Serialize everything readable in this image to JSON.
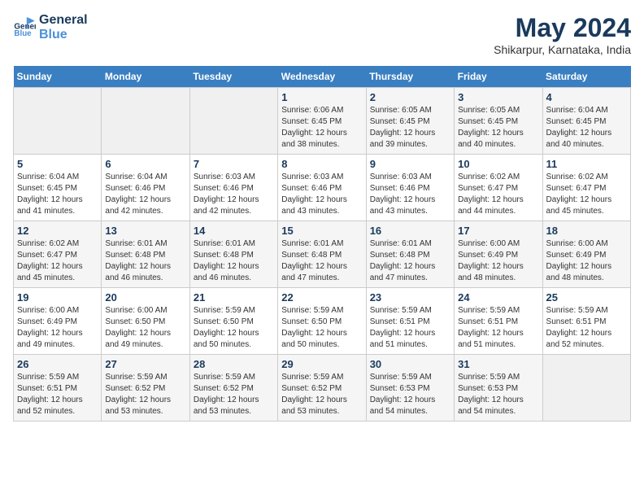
{
  "logo": {
    "line1": "General",
    "line2": "Blue"
  },
  "title": "May 2024",
  "location": "Shikarpur, Karnataka, India",
  "days_of_week": [
    "Sunday",
    "Monday",
    "Tuesday",
    "Wednesday",
    "Thursday",
    "Friday",
    "Saturday"
  ],
  "weeks": [
    [
      {
        "day": "",
        "info": ""
      },
      {
        "day": "",
        "info": ""
      },
      {
        "day": "",
        "info": ""
      },
      {
        "day": "1",
        "info": "Sunrise: 6:06 AM\nSunset: 6:45 PM\nDaylight: 12 hours\nand 38 minutes."
      },
      {
        "day": "2",
        "info": "Sunrise: 6:05 AM\nSunset: 6:45 PM\nDaylight: 12 hours\nand 39 minutes."
      },
      {
        "day": "3",
        "info": "Sunrise: 6:05 AM\nSunset: 6:45 PM\nDaylight: 12 hours\nand 40 minutes."
      },
      {
        "day": "4",
        "info": "Sunrise: 6:04 AM\nSunset: 6:45 PM\nDaylight: 12 hours\nand 40 minutes."
      }
    ],
    [
      {
        "day": "5",
        "info": "Sunrise: 6:04 AM\nSunset: 6:45 PM\nDaylight: 12 hours\nand 41 minutes."
      },
      {
        "day": "6",
        "info": "Sunrise: 6:04 AM\nSunset: 6:46 PM\nDaylight: 12 hours\nand 42 minutes."
      },
      {
        "day": "7",
        "info": "Sunrise: 6:03 AM\nSunset: 6:46 PM\nDaylight: 12 hours\nand 42 minutes."
      },
      {
        "day": "8",
        "info": "Sunrise: 6:03 AM\nSunset: 6:46 PM\nDaylight: 12 hours\nand 43 minutes."
      },
      {
        "day": "9",
        "info": "Sunrise: 6:03 AM\nSunset: 6:46 PM\nDaylight: 12 hours\nand 43 minutes."
      },
      {
        "day": "10",
        "info": "Sunrise: 6:02 AM\nSunset: 6:47 PM\nDaylight: 12 hours\nand 44 minutes."
      },
      {
        "day": "11",
        "info": "Sunrise: 6:02 AM\nSunset: 6:47 PM\nDaylight: 12 hours\nand 45 minutes."
      }
    ],
    [
      {
        "day": "12",
        "info": "Sunrise: 6:02 AM\nSunset: 6:47 PM\nDaylight: 12 hours\nand 45 minutes."
      },
      {
        "day": "13",
        "info": "Sunrise: 6:01 AM\nSunset: 6:48 PM\nDaylight: 12 hours\nand 46 minutes."
      },
      {
        "day": "14",
        "info": "Sunrise: 6:01 AM\nSunset: 6:48 PM\nDaylight: 12 hours\nand 46 minutes."
      },
      {
        "day": "15",
        "info": "Sunrise: 6:01 AM\nSunset: 6:48 PM\nDaylight: 12 hours\nand 47 minutes."
      },
      {
        "day": "16",
        "info": "Sunrise: 6:01 AM\nSunset: 6:48 PM\nDaylight: 12 hours\nand 47 minutes."
      },
      {
        "day": "17",
        "info": "Sunrise: 6:00 AM\nSunset: 6:49 PM\nDaylight: 12 hours\nand 48 minutes."
      },
      {
        "day": "18",
        "info": "Sunrise: 6:00 AM\nSunset: 6:49 PM\nDaylight: 12 hours\nand 48 minutes."
      }
    ],
    [
      {
        "day": "19",
        "info": "Sunrise: 6:00 AM\nSunset: 6:49 PM\nDaylight: 12 hours\nand 49 minutes."
      },
      {
        "day": "20",
        "info": "Sunrise: 6:00 AM\nSunset: 6:50 PM\nDaylight: 12 hours\nand 49 minutes."
      },
      {
        "day": "21",
        "info": "Sunrise: 5:59 AM\nSunset: 6:50 PM\nDaylight: 12 hours\nand 50 minutes."
      },
      {
        "day": "22",
        "info": "Sunrise: 5:59 AM\nSunset: 6:50 PM\nDaylight: 12 hours\nand 50 minutes."
      },
      {
        "day": "23",
        "info": "Sunrise: 5:59 AM\nSunset: 6:51 PM\nDaylight: 12 hours\nand 51 minutes."
      },
      {
        "day": "24",
        "info": "Sunrise: 5:59 AM\nSunset: 6:51 PM\nDaylight: 12 hours\nand 51 minutes."
      },
      {
        "day": "25",
        "info": "Sunrise: 5:59 AM\nSunset: 6:51 PM\nDaylight: 12 hours\nand 52 minutes."
      }
    ],
    [
      {
        "day": "26",
        "info": "Sunrise: 5:59 AM\nSunset: 6:51 PM\nDaylight: 12 hours\nand 52 minutes."
      },
      {
        "day": "27",
        "info": "Sunrise: 5:59 AM\nSunset: 6:52 PM\nDaylight: 12 hours\nand 53 minutes."
      },
      {
        "day": "28",
        "info": "Sunrise: 5:59 AM\nSunset: 6:52 PM\nDaylight: 12 hours\nand 53 minutes."
      },
      {
        "day": "29",
        "info": "Sunrise: 5:59 AM\nSunset: 6:52 PM\nDaylight: 12 hours\nand 53 minutes."
      },
      {
        "day": "30",
        "info": "Sunrise: 5:59 AM\nSunset: 6:53 PM\nDaylight: 12 hours\nand 54 minutes."
      },
      {
        "day": "31",
        "info": "Sunrise: 5:59 AM\nSunset: 6:53 PM\nDaylight: 12 hours\nand 54 minutes."
      },
      {
        "day": "",
        "info": ""
      }
    ]
  ]
}
